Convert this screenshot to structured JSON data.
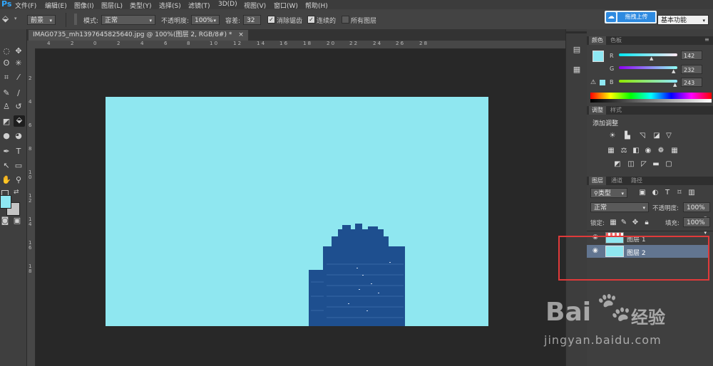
{
  "menubar": {
    "logo": "Ps",
    "items": [
      "文件(F)",
      "编辑(E)",
      "图像(I)",
      "图层(L)",
      "类型(Y)",
      "选择(S)",
      "滤镜(T)",
      "3D(D)",
      "视图(V)",
      "窗口(W)",
      "帮助(H)"
    ],
    "upload_button": "拖拽上传",
    "workspace": "基本功能"
  },
  "options": {
    "fill_source": "前景",
    "mode_label": "模式:",
    "mode_value": "正常",
    "opacity_label": "不透明度:",
    "opacity_value": "100%",
    "tolerance_label": "容差:",
    "tolerance_value": "32",
    "antialias_label": "消除锯齿",
    "contiguous_label": "连续的",
    "all_layers_label": "所有图层"
  },
  "document": {
    "tab_title": "IMAG0735_mh1397645825640.jpg @ 100%(图层 2, RGB/8#) *",
    "close": "×"
  },
  "rulers": {
    "horizontal": [
      "4",
      "2",
      "0",
      "2",
      "4",
      "6",
      "8",
      "1 0",
      "1 2",
      "1 4",
      "1 6",
      "1 8",
      "2 0",
      "2 2",
      "2 4",
      "2 6",
      "2 8"
    ],
    "vertical": [
      "2",
      "4",
      "6",
      "8",
      "1 0",
      "1 2",
      "1 4",
      "1 6",
      "1 8"
    ]
  },
  "color_panel": {
    "tabs": [
      "颜色",
      "色板"
    ],
    "r_label": "R",
    "r_value": "142",
    "g_label": "G",
    "g_value": "232",
    "b_label": "B",
    "b_value": "243",
    "foreground_color": "#8ee8f3",
    "r": 142,
    "g": 232,
    "b": 243
  },
  "adjust_panel": {
    "tabs": [
      "调整",
      "样式"
    ],
    "title": "添加调整"
  },
  "layers_panel": {
    "tabs": [
      "图层",
      "通道",
      "路径"
    ],
    "filter_kind": "类型",
    "blend_mode": "正常",
    "opacity_label": "不透明度:",
    "opacity_value": "100%",
    "lock_label": "锁定:",
    "fill_label": "填充:",
    "fill_value": "100%",
    "layers": [
      {
        "name": "图层 1",
        "selected": false
      },
      {
        "name": "图层 2",
        "selected": true
      }
    ]
  },
  "watermark": {
    "brand": "Bai",
    "brand_suffix": "经验",
    "url": "jingyan.baidu.com"
  },
  "colors": {
    "canvas": "#8fe7f0",
    "building": "#1e4f8f",
    "highlight_box": "#e03a3a"
  }
}
